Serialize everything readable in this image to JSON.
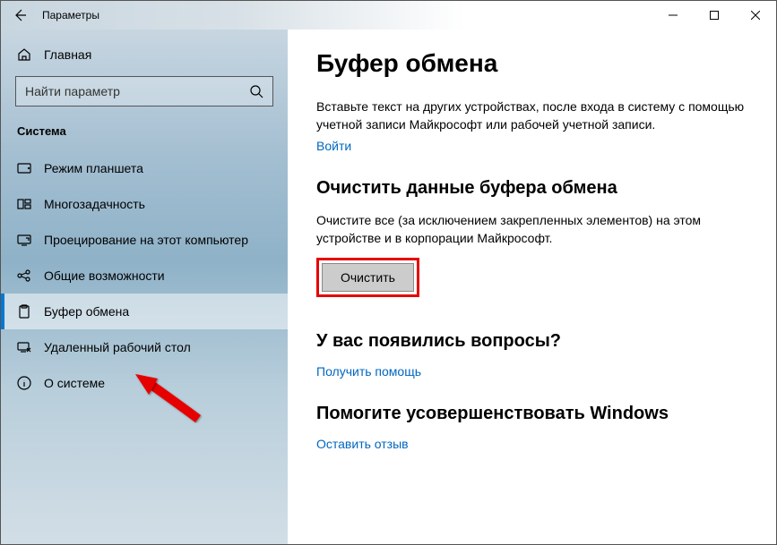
{
  "titlebar": {
    "title": "Параметры"
  },
  "sidebar": {
    "home": "Главная",
    "search_placeholder": "Найти параметр",
    "section": "Система",
    "items": [
      {
        "label": "Режим планшета"
      },
      {
        "label": "Многозадачность"
      },
      {
        "label": "Проецирование на этот компьютер"
      },
      {
        "label": "Общие возможности"
      },
      {
        "label": "Буфер обмена"
      },
      {
        "label": "Удаленный рабочий стол"
      },
      {
        "label": "О системе"
      }
    ]
  },
  "main": {
    "h1": "Буфер обмена",
    "sync_desc": "Вставьте текст на других устройствах, после входа в систему с помощью учетной записи Майкрософт или рабочей учетной записи.",
    "sync_link": "Войти",
    "clear_h2": "Очистить данные буфера обмена",
    "clear_desc": "Очистите все (за исключением закрепленных элементов) на этом устройстве и в корпорации Майкрософт.",
    "clear_button": "Очистить",
    "help_h2": "У вас появились вопросы?",
    "help_link": "Получить помощь",
    "feedback_h2": "Помогите усовершенствовать Windows",
    "feedback_link": "Оставить отзыв"
  }
}
